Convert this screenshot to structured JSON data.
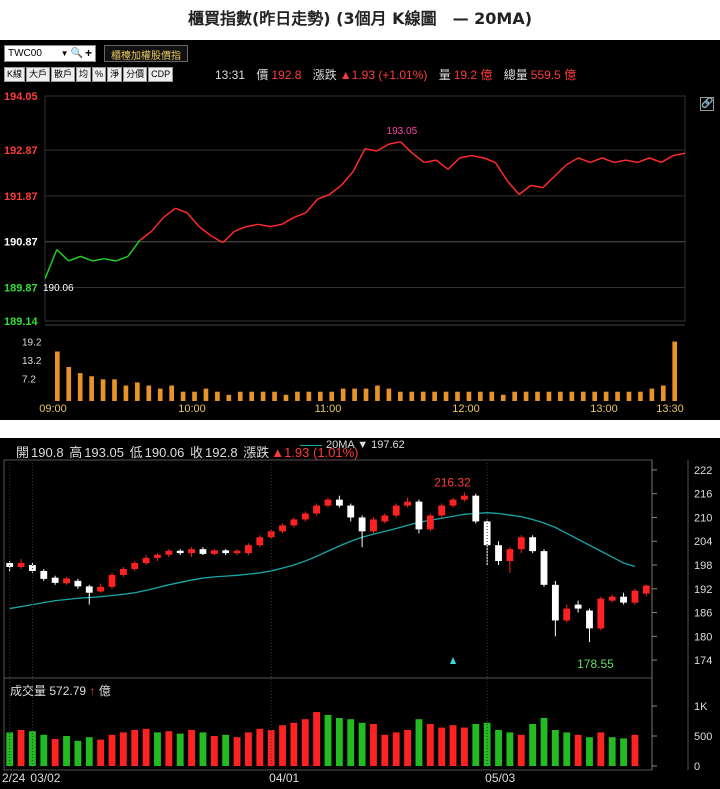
{
  "page": {
    "title": "櫃買指數(昨日走勢) (3個月 K線圖　— 20MA)"
  },
  "intraday": {
    "symbol": "TWC00",
    "add_watch_label": "櫃檯加權股價指",
    "buttons": [
      "K線",
      "大戶",
      "散戶",
      "均",
      "%",
      "淨",
      "分價",
      "CDP"
    ],
    "quote": {
      "time": "13:31",
      "price_label": "價",
      "price": "192.8",
      "change_label": "漲跌",
      "change": "▲1.93 (+1.01%)",
      "volume_label": "量",
      "volume": "19.2 億",
      "total_label": "總量",
      "total": "559.5 億"
    },
    "colors": {
      "up": "#ff2a2a",
      "down": "#22cc22",
      "volume": "#e8932a",
      "grid": "#333333"
    },
    "chart_data": {
      "type": "line",
      "title": "",
      "yticks": [
        194.05,
        192.87,
        191.87,
        190.87,
        189.87,
        189.14
      ],
      "ylim": [
        189.14,
        194.05
      ],
      "reference": 190.87,
      "xticks": [
        "09:00",
        "10:00",
        "11:00",
        "12:00",
        "13:00",
        "13:30"
      ],
      "high_label": "193.05",
      "low_label": "190.06",
      "series": [
        {
          "x": [
            "09:00",
            "09:05",
            "09:10",
            "09:15",
            "09:20",
            "09:25",
            "09:30",
            "09:35",
            "09:40",
            "09:45",
            "09:50",
            "09:55",
            "10:00",
            "10:05",
            "10:10",
            "10:15",
            "10:20",
            "10:25",
            "10:30",
            "10:35",
            "10:40",
            "10:45",
            "10:50",
            "10:55",
            "11:00",
            "11:05",
            "11:10",
            "11:15",
            "11:20",
            "11:25",
            "11:30",
            "11:35",
            "11:40",
            "11:45",
            "11:50",
            "11:55",
            "12:00",
            "12:05",
            "12:10",
            "12:15",
            "12:20",
            "12:25",
            "12:30",
            "12:35",
            "12:40",
            "12:45",
            "12:50",
            "12:55",
            "13:00",
            "13:05",
            "13:10",
            "13:15",
            "13:20",
            "13:25",
            "13:30"
          ],
          "values": [
            190.06,
            190.7,
            190.45,
            190.55,
            190.45,
            190.5,
            190.45,
            190.55,
            190.9,
            191.1,
            191.4,
            191.6,
            191.5,
            191.2,
            191.0,
            190.85,
            191.1,
            191.2,
            191.25,
            191.2,
            191.25,
            191.4,
            191.5,
            191.8,
            191.9,
            192.1,
            192.4,
            192.9,
            192.85,
            193.0,
            193.05,
            192.8,
            192.6,
            192.65,
            192.45,
            192.7,
            192.75,
            192.7,
            192.6,
            192.2,
            191.9,
            192.1,
            192.05,
            192.3,
            192.55,
            192.7,
            192.6,
            192.7,
            192.6,
            192.65,
            192.6,
            192.7,
            192.6,
            192.75,
            192.8
          ]
        }
      ],
      "volume": {
        "yticks": [
          19.2,
          13.2,
          7.2
        ],
        "ylim": [
          0,
          21
        ],
        "values": [
          16,
          11,
          9,
          8,
          7,
          7,
          5,
          6,
          5,
          4,
          5,
          3,
          3,
          4,
          3,
          2,
          3,
          3,
          3,
          3,
          2,
          3,
          3,
          3,
          3,
          4,
          4,
          4,
          5,
          4,
          3,
          3,
          3,
          3,
          3,
          3,
          3,
          3,
          3,
          2,
          3,
          3,
          3,
          3,
          3,
          3,
          3,
          3,
          3,
          3,
          3,
          3,
          4,
          5,
          19.2
        ]
      }
    }
  },
  "kline": {
    "ohlc": {
      "open_label": "開",
      "open": "190.8",
      "high_label": "高",
      "high": "193.05",
      "low_label": "低",
      "low": "190.06",
      "close_label": "收",
      "close": "192.8",
      "change_label": "漲跌",
      "change": "▲1.93 (1.01%)"
    },
    "ma_legend": {
      "label": "20MA",
      "value": "▼ 197.62"
    },
    "volume_legend": {
      "label": "成交量",
      "value": "572.79",
      "arrow": "↑",
      "unit": "億"
    },
    "colors": {
      "up": "#ff2222",
      "down": "#ffffff",
      "vol_up": "#ff2222",
      "vol_down": "#22bb22",
      "ma": "#1aa6a6",
      "grid": "#2a2a2a"
    },
    "chart_data": {
      "type": "candlestick",
      "title": "",
      "yticks": [
        222,
        216,
        210,
        204,
        198,
        192,
        186,
        180,
        174
      ],
      "ylim": [
        172,
        224
      ],
      "volume_yticks": [
        "1K",
        "500",
        "0"
      ],
      "volume_ylim": [
        0,
        1300
      ],
      "xticks": [
        {
          "index": 0,
          "label": "2/24"
        },
        {
          "index": 2,
          "label": "03/02"
        },
        {
          "index": 23,
          "label": "04/01"
        },
        {
          "index": 42,
          "label": "05/03"
        }
      ],
      "max_label": "216.32",
      "min_label": "178.55",
      "candles": [
        {
          "o": 198.5,
          "c": 197.5,
          "h": 199.0,
          "l": 196.5
        },
        {
          "o": 197.5,
          "c": 198.5,
          "h": 199.5,
          "l": 197.0
        },
        {
          "o": 198.0,
          "c": 196.5,
          "h": 198.5,
          "l": 196.0
        },
        {
          "o": 196.5,
          "c": 194.5,
          "h": 197.0,
          "l": 194.0
        },
        {
          "o": 194.8,
          "c": 193.5,
          "h": 195.3,
          "l": 193.0
        },
        {
          "o": 193.4,
          "c": 194.6,
          "h": 195.0,
          "l": 193.0
        },
        {
          "o": 194.0,
          "c": 192.6,
          "h": 194.5,
          "l": 192.0
        },
        {
          "o": 192.6,
          "c": 191.0,
          "h": 193.0,
          "l": 188.0
        },
        {
          "o": 191.3,
          "c": 192.5,
          "h": 193.3,
          "l": 191.0
        },
        {
          "o": 192.5,
          "c": 195.5,
          "h": 196.0,
          "l": 192.0
        },
        {
          "o": 195.5,
          "c": 197.0,
          "h": 197.5,
          "l": 195.0
        },
        {
          "o": 197.0,
          "c": 198.5,
          "h": 199.0,
          "l": 196.5
        },
        {
          "o": 198.5,
          "c": 199.8,
          "h": 200.5,
          "l": 198.0
        },
        {
          "o": 199.8,
          "c": 200.6,
          "h": 201.0,
          "l": 199.0
        },
        {
          "o": 200.6,
          "c": 201.6,
          "h": 202.0,
          "l": 200.0
        },
        {
          "o": 201.6,
          "c": 201.0,
          "h": 202.0,
          "l": 200.5
        },
        {
          "o": 201.0,
          "c": 202.0,
          "h": 202.5,
          "l": 200.0
        },
        {
          "o": 202.0,
          "c": 200.8,
          "h": 202.5,
          "l": 200.5
        },
        {
          "o": 200.8,
          "c": 201.7,
          "h": 202.0,
          "l": 200.5
        },
        {
          "o": 201.7,
          "c": 201.0,
          "h": 202.0,
          "l": 200.5
        },
        {
          "o": 201.0,
          "c": 201.6,
          "h": 202.0,
          "l": 200.5
        },
        {
          "o": 201.0,
          "c": 203.0,
          "h": 203.5,
          "l": 200.5
        },
        {
          "o": 203.0,
          "c": 205.0,
          "h": 205.5,
          "l": 202.5
        },
        {
          "o": 205.0,
          "c": 206.5,
          "h": 207.0,
          "l": 204.5
        },
        {
          "o": 206.5,
          "c": 208.0,
          "h": 208.5,
          "l": 206.0
        },
        {
          "o": 208.0,
          "c": 209.5,
          "h": 210.0,
          "l": 207.5
        },
        {
          "o": 209.5,
          "c": 211.0,
          "h": 211.5,
          "l": 209.0
        },
        {
          "o": 211.0,
          "c": 213.0,
          "h": 213.5,
          "l": 210.5
        },
        {
          "o": 213.0,
          "c": 214.5,
          "h": 215.0,
          "l": 212.5
        },
        {
          "o": 214.5,
          "c": 213.0,
          "h": 215.5,
          "l": 212.5
        },
        {
          "o": 213.0,
          "c": 210.0,
          "h": 213.5,
          "l": 209.0
        },
        {
          "o": 210.0,
          "c": 206.5,
          "h": 210.5,
          "l": 202.5
        },
        {
          "o": 206.5,
          "c": 209.5,
          "h": 210.0,
          "l": 206.0
        },
        {
          "o": 209.0,
          "c": 210.5,
          "h": 211.0,
          "l": 208.5
        },
        {
          "o": 210.5,
          "c": 213.0,
          "h": 213.5,
          "l": 210.0
        },
        {
          "o": 213.0,
          "c": 214.0,
          "h": 215.0,
          "l": 212.5
        },
        {
          "o": 214.0,
          "c": 207.0,
          "h": 214.5,
          "l": 206.0
        },
        {
          "o": 207.0,
          "c": 210.5,
          "h": 211.0,
          "l": 206.5
        },
        {
          "o": 210.5,
          "c": 213.0,
          "h": 213.5,
          "l": 210.0
        },
        {
          "o": 213.0,
          "c": 214.5,
          "h": 215.0,
          "l": 212.5
        },
        {
          "o": 214.5,
          "c": 215.5,
          "h": 216.32,
          "l": 214.0
        },
        {
          "o": 215.5,
          "c": 209.0,
          "h": 216.0,
          "l": 208.5
        },
        {
          "o": 209.0,
          "c": 203.0,
          "h": 209.5,
          "l": 198.0
        },
        {
          "o": 203.0,
          "c": 199.0,
          "h": 204.0,
          "l": 198.0
        },
        {
          "o": 199.0,
          "c": 202.0,
          "h": 202.5,
          "l": 196.0
        },
        {
          "o": 202.0,
          "c": 205.0,
          "h": 205.5,
          "l": 201.0
        },
        {
          "o": 205.0,
          "c": 201.5,
          "h": 205.5,
          "l": 201.0
        },
        {
          "o": 201.5,
          "c": 193.0,
          "h": 202.0,
          "l": 192.5
        },
        {
          "o": 193.0,
          "c": 184.0,
          "h": 194.0,
          "l": 180.0
        },
        {
          "o": 184.0,
          "c": 187.0,
          "h": 188.0,
          "l": 183.5
        },
        {
          "o": 188.0,
          "c": 187.0,
          "h": 189.0,
          "l": 186.0
        },
        {
          "o": 186.5,
          "c": 182.0,
          "h": 187.0,
          "l": 178.55
        },
        {
          "o": 182.0,
          "c": 189.5,
          "h": 190.0,
          "l": 181.5
        },
        {
          "o": 189.0,
          "c": 190.0,
          "h": 190.5,
          "l": 188.5
        },
        {
          "o": 190.0,
          "c": 188.5,
          "h": 191.0,
          "l": 188.0
        },
        {
          "o": 188.5,
          "c": 191.5,
          "h": 192.0,
          "l": 188.0
        },
        {
          "o": 190.8,
          "c": 192.8,
          "h": 193.05,
          "l": 190.06
        }
      ],
      "ma": [
        187.0,
        187.5,
        188.0,
        188.5,
        189.0,
        189.3,
        189.6,
        189.8,
        190.0,
        190.3,
        190.6,
        191.0,
        191.6,
        192.3,
        193.0,
        193.6,
        194.2,
        194.7,
        195.0,
        195.2,
        195.4,
        195.7,
        196.0,
        196.5,
        197.2,
        198.0,
        199.0,
        200.2,
        201.5,
        202.8,
        204.0,
        205.0,
        205.8,
        206.5,
        207.2,
        208.0,
        208.8,
        209.3,
        209.8,
        210.3,
        210.8,
        211.0,
        211.2,
        211.0,
        210.6,
        210.2,
        209.5,
        208.6,
        207.5,
        206.0,
        204.5,
        203.0,
        201.5,
        200.0,
        198.5,
        197.62
      ],
      "volume": [
        {
          "v": 560,
          "up": false
        },
        {
          "v": 600,
          "up": true
        },
        {
          "v": 580,
          "up": false
        },
        {
          "v": 520,
          "up": false
        },
        {
          "v": 450,
          "up": true
        },
        {
          "v": 500,
          "up": false
        },
        {
          "v": 420,
          "up": false
        },
        {
          "v": 480,
          "up": false
        },
        {
          "v": 440,
          "up": true
        },
        {
          "v": 520,
          "up": true
        },
        {
          "v": 560,
          "up": true
        },
        {
          "v": 600,
          "up": true
        },
        {
          "v": 620,
          "up": true
        },
        {
          "v": 560,
          "up": false
        },
        {
          "v": 580,
          "up": true
        },
        {
          "v": 540,
          "up": false
        },
        {
          "v": 600,
          "up": true
        },
        {
          "v": 560,
          "up": false
        },
        {
          "v": 500,
          "up": true
        },
        {
          "v": 520,
          "up": false
        },
        {
          "v": 480,
          "up": true
        },
        {
          "v": 560,
          "up": true
        },
        {
          "v": 620,
          "up": true
        },
        {
          "v": 600,
          "up": true
        },
        {
          "v": 680,
          "up": true
        },
        {
          "v": 720,
          "up": true
        },
        {
          "v": 780,
          "up": true
        },
        {
          "v": 900,
          "up": true
        },
        {
          "v": 850,
          "up": false
        },
        {
          "v": 800,
          "up": false
        },
        {
          "v": 780,
          "up": false
        },
        {
          "v": 720,
          "up": false
        },
        {
          "v": 700,
          "up": true
        },
        {
          "v": 520,
          "up": true
        },
        {
          "v": 560,
          "up": true
        },
        {
          "v": 600,
          "up": true
        },
        {
          "v": 780,
          "up": false
        },
        {
          "v": 700,
          "up": true
        },
        {
          "v": 640,
          "up": true
        },
        {
          "v": 680,
          "up": true
        },
        {
          "v": 640,
          "up": true
        },
        {
          "v": 700,
          "up": false
        },
        {
          "v": 720,
          "up": false
        },
        {
          "v": 600,
          "up": false
        },
        {
          "v": 560,
          "up": false
        },
        {
          "v": 520,
          "up": true
        },
        {
          "v": 700,
          "up": false
        },
        {
          "v": 800,
          "up": false
        },
        {
          "v": 600,
          "up": false
        },
        {
          "v": 560,
          "up": false
        },
        {
          "v": 520,
          "up": true
        },
        {
          "v": 480,
          "up": false
        },
        {
          "v": 560,
          "up": true
        },
        {
          "v": 480,
          "up": false
        },
        {
          "v": 460,
          "up": false
        },
        {
          "v": 520,
          "up": true
        }
      ]
    }
  }
}
